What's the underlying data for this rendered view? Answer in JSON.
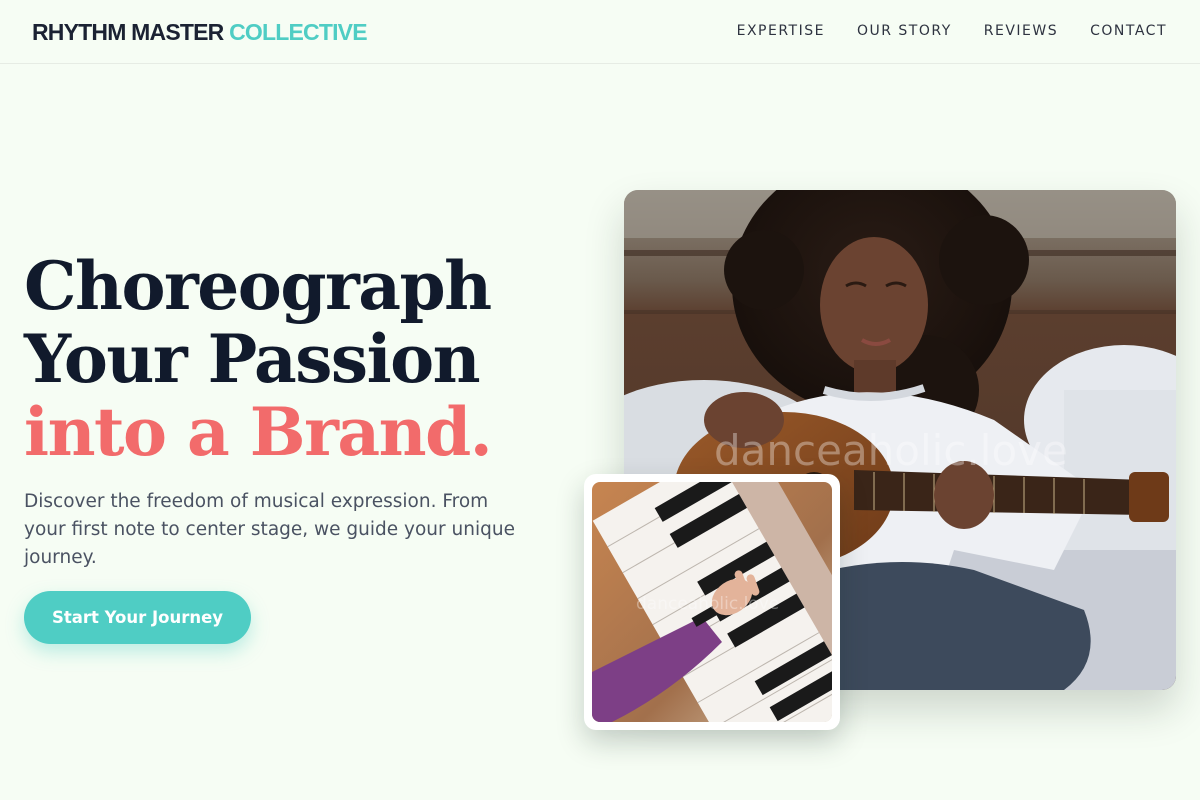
{
  "header": {
    "brand_primary": "RHYTHM MASTER",
    "brand_accent": "COLLECTIVE",
    "nav": [
      {
        "label": "EXPERTISE"
      },
      {
        "label": "OUR STORY"
      },
      {
        "label": "REVIEWS"
      },
      {
        "label": "CONTACT"
      }
    ]
  },
  "hero": {
    "headline_line1": "Choreograph",
    "headline_line2": "Your Passion",
    "headline_accent": "into a Brand.",
    "subtitle": "Discover the freedom of musical expression. From your first note to center stage, we guide your unique journey.",
    "cta_label": "Start Your Journey"
  },
  "images": {
    "main_watermark": "danceaholic.love",
    "small_watermark": "danceaholic.love"
  },
  "colors": {
    "background": "#f6fdf4",
    "accent_teal": "#4fcdc4",
    "accent_coral": "#f26b6b",
    "text_dark": "#111a2c"
  }
}
